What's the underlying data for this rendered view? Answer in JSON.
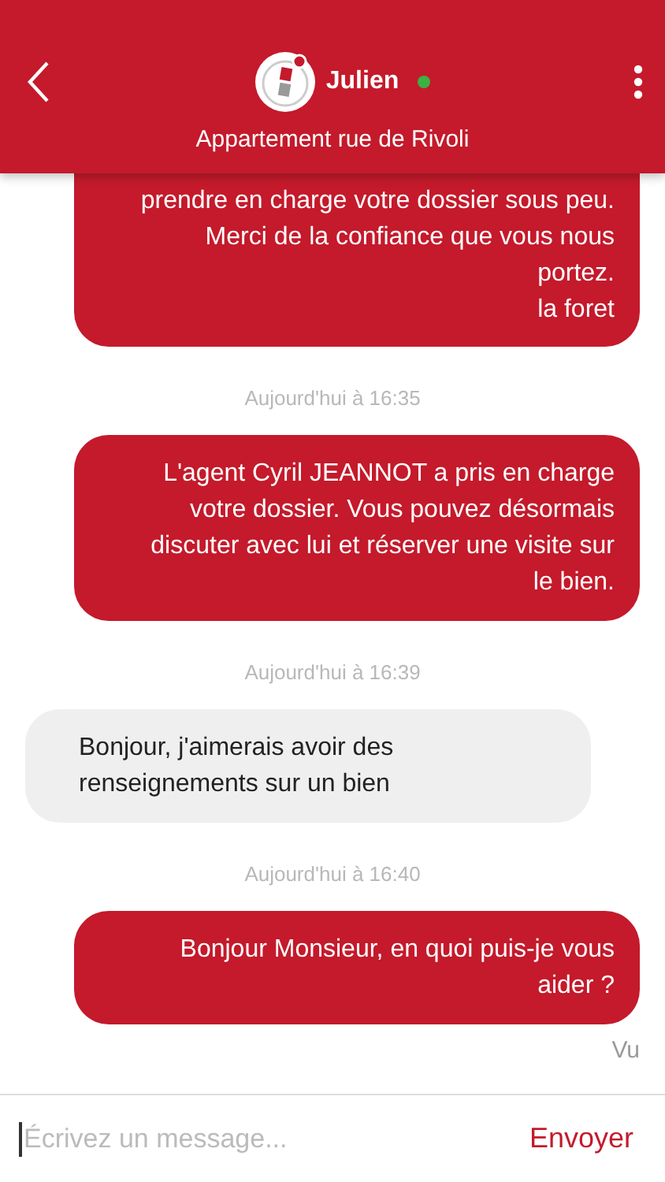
{
  "header": {
    "contact": "Julien",
    "online": true,
    "subtitle": "Appartement rue de Rivoli"
  },
  "messages": [
    {
      "kind": "outgoing",
      "text": "prendre en charge votre dossier sous peu. Merci de la confiance que vous nous portez.\nla foret",
      "cut_top": true
    },
    {
      "kind": "timestamp",
      "text": "Aujourd'hui à 16:35"
    },
    {
      "kind": "outgoing",
      "text": "L'agent Cyril JEANNOT a pris en charge votre dossier. Vous pouvez désormais discuter avec lui et réserver une visite sur le bien."
    },
    {
      "kind": "timestamp",
      "text": "Aujourd'hui à 16:39"
    },
    {
      "kind": "incoming",
      "text": "Bonjour, j'aimerais avoir des renseignements sur un bien"
    },
    {
      "kind": "timestamp",
      "text": "Aujourd'hui à 16:40"
    },
    {
      "kind": "outgoing",
      "text": "Bonjour Monsieur, en quoi puis-je vous aider ?"
    }
  ],
  "read_receipt": "Vu",
  "composer": {
    "placeholder": "Écrivez un message...",
    "send": "Envoyer"
  }
}
